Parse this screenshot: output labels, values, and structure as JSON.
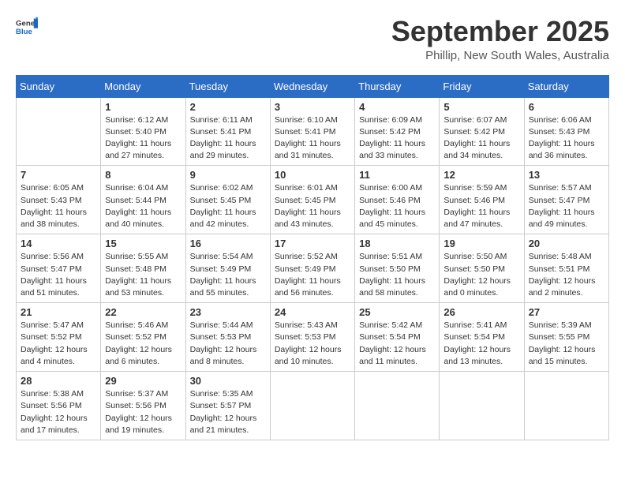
{
  "logo": {
    "general": "General",
    "blue": "Blue"
  },
  "title": "September 2025",
  "location": "Phillip, New South Wales, Australia",
  "days_of_week": [
    "Sunday",
    "Monday",
    "Tuesday",
    "Wednesday",
    "Thursday",
    "Friday",
    "Saturday"
  ],
  "weeks": [
    [
      {
        "day": "",
        "info": ""
      },
      {
        "day": "1",
        "info": "Sunrise: 6:12 AM\nSunset: 5:40 PM\nDaylight: 11 hours\nand 27 minutes."
      },
      {
        "day": "2",
        "info": "Sunrise: 6:11 AM\nSunset: 5:41 PM\nDaylight: 11 hours\nand 29 minutes."
      },
      {
        "day": "3",
        "info": "Sunrise: 6:10 AM\nSunset: 5:41 PM\nDaylight: 11 hours\nand 31 minutes."
      },
      {
        "day": "4",
        "info": "Sunrise: 6:09 AM\nSunset: 5:42 PM\nDaylight: 11 hours\nand 33 minutes."
      },
      {
        "day": "5",
        "info": "Sunrise: 6:07 AM\nSunset: 5:42 PM\nDaylight: 11 hours\nand 34 minutes."
      },
      {
        "day": "6",
        "info": "Sunrise: 6:06 AM\nSunset: 5:43 PM\nDaylight: 11 hours\nand 36 minutes."
      }
    ],
    [
      {
        "day": "7",
        "info": "Sunrise: 6:05 AM\nSunset: 5:43 PM\nDaylight: 11 hours\nand 38 minutes."
      },
      {
        "day": "8",
        "info": "Sunrise: 6:04 AM\nSunset: 5:44 PM\nDaylight: 11 hours\nand 40 minutes."
      },
      {
        "day": "9",
        "info": "Sunrise: 6:02 AM\nSunset: 5:45 PM\nDaylight: 11 hours\nand 42 minutes."
      },
      {
        "day": "10",
        "info": "Sunrise: 6:01 AM\nSunset: 5:45 PM\nDaylight: 11 hours\nand 43 minutes."
      },
      {
        "day": "11",
        "info": "Sunrise: 6:00 AM\nSunset: 5:46 PM\nDaylight: 11 hours\nand 45 minutes."
      },
      {
        "day": "12",
        "info": "Sunrise: 5:59 AM\nSunset: 5:46 PM\nDaylight: 11 hours\nand 47 minutes."
      },
      {
        "day": "13",
        "info": "Sunrise: 5:57 AM\nSunset: 5:47 PM\nDaylight: 11 hours\nand 49 minutes."
      }
    ],
    [
      {
        "day": "14",
        "info": "Sunrise: 5:56 AM\nSunset: 5:47 PM\nDaylight: 11 hours\nand 51 minutes."
      },
      {
        "day": "15",
        "info": "Sunrise: 5:55 AM\nSunset: 5:48 PM\nDaylight: 11 hours\nand 53 minutes."
      },
      {
        "day": "16",
        "info": "Sunrise: 5:54 AM\nSunset: 5:49 PM\nDaylight: 11 hours\nand 55 minutes."
      },
      {
        "day": "17",
        "info": "Sunrise: 5:52 AM\nSunset: 5:49 PM\nDaylight: 11 hours\nand 56 minutes."
      },
      {
        "day": "18",
        "info": "Sunrise: 5:51 AM\nSunset: 5:50 PM\nDaylight: 11 hours\nand 58 minutes."
      },
      {
        "day": "19",
        "info": "Sunrise: 5:50 AM\nSunset: 5:50 PM\nDaylight: 12 hours\nand 0 minutes."
      },
      {
        "day": "20",
        "info": "Sunrise: 5:48 AM\nSunset: 5:51 PM\nDaylight: 12 hours\nand 2 minutes."
      }
    ],
    [
      {
        "day": "21",
        "info": "Sunrise: 5:47 AM\nSunset: 5:52 PM\nDaylight: 12 hours\nand 4 minutes."
      },
      {
        "day": "22",
        "info": "Sunrise: 5:46 AM\nSunset: 5:52 PM\nDaylight: 12 hours\nand 6 minutes."
      },
      {
        "day": "23",
        "info": "Sunrise: 5:44 AM\nSunset: 5:53 PM\nDaylight: 12 hours\nand 8 minutes."
      },
      {
        "day": "24",
        "info": "Sunrise: 5:43 AM\nSunset: 5:53 PM\nDaylight: 12 hours\nand 10 minutes."
      },
      {
        "day": "25",
        "info": "Sunrise: 5:42 AM\nSunset: 5:54 PM\nDaylight: 12 hours\nand 11 minutes."
      },
      {
        "day": "26",
        "info": "Sunrise: 5:41 AM\nSunset: 5:54 PM\nDaylight: 12 hours\nand 13 minutes."
      },
      {
        "day": "27",
        "info": "Sunrise: 5:39 AM\nSunset: 5:55 PM\nDaylight: 12 hours\nand 15 minutes."
      }
    ],
    [
      {
        "day": "28",
        "info": "Sunrise: 5:38 AM\nSunset: 5:56 PM\nDaylight: 12 hours\nand 17 minutes."
      },
      {
        "day": "29",
        "info": "Sunrise: 5:37 AM\nSunset: 5:56 PM\nDaylight: 12 hours\nand 19 minutes."
      },
      {
        "day": "30",
        "info": "Sunrise: 5:35 AM\nSunset: 5:57 PM\nDaylight: 12 hours\nand 21 minutes."
      },
      {
        "day": "",
        "info": ""
      },
      {
        "day": "",
        "info": ""
      },
      {
        "day": "",
        "info": ""
      },
      {
        "day": "",
        "info": ""
      }
    ]
  ]
}
